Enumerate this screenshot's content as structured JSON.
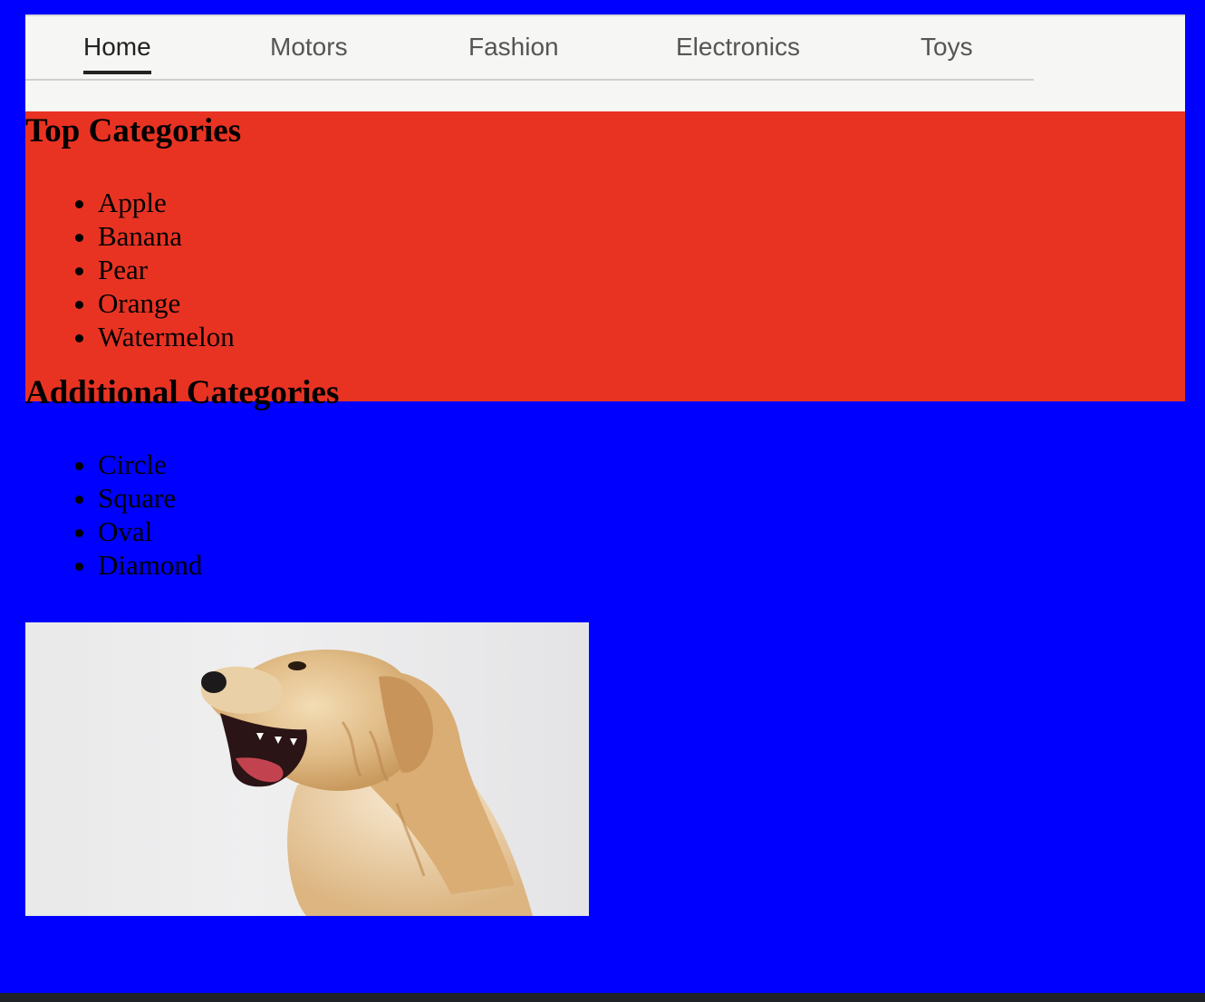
{
  "nav": {
    "tabs": [
      {
        "label": "Home",
        "active": true
      },
      {
        "label": "Motors",
        "active": false
      },
      {
        "label": "Fashion",
        "active": false
      },
      {
        "label": "Electronics",
        "active": false
      },
      {
        "label": "Toys",
        "active": false
      }
    ]
  },
  "top_categories": {
    "heading": "Top Categories",
    "items": [
      "Apple",
      "Banana",
      "Pear",
      "Orange",
      "Watermelon"
    ]
  },
  "additional_categories": {
    "heading": "Additional Categories",
    "items": [
      "Circle",
      "Square",
      "Oval",
      "Diamond"
    ]
  },
  "image": {
    "subject": "yawning golden retriever dog"
  },
  "colors": {
    "page_background": "#0000ff",
    "section_background": "#e83323",
    "navbar_background": "#f6f6f4"
  }
}
